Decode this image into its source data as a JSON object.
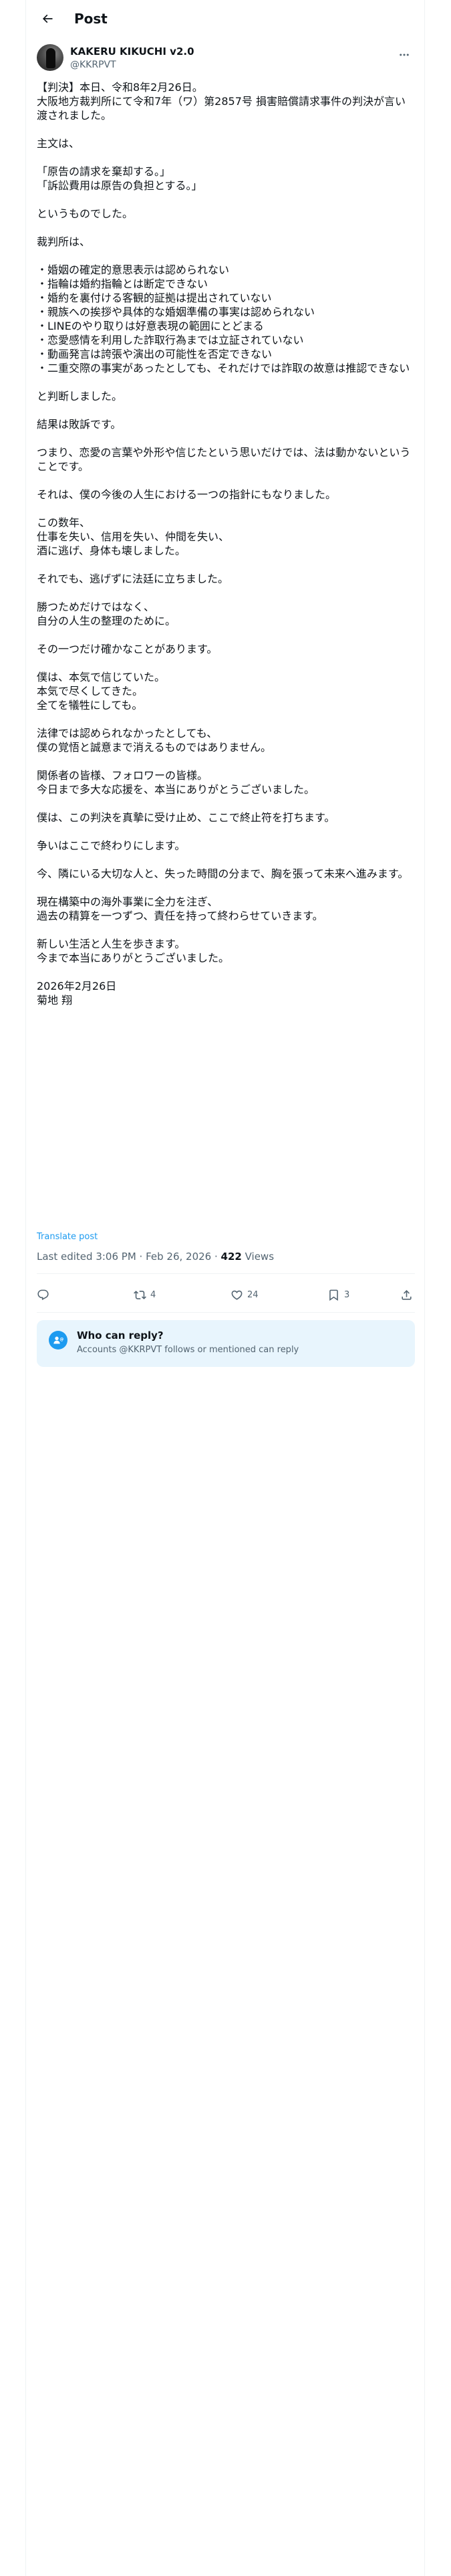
{
  "header": {
    "title": "Post"
  },
  "author": {
    "name": "KAKERU KIKUCHI v2.0",
    "handle": "@KKRPVT"
  },
  "post": {
    "text": "【判決】本日、令和8年2月26日。\n大阪地方裁判所にて令和7年（ワ）第2857号 損害賠償請求事件の判決が言い渡されました。\n\n主文は、\n\n「原告の請求を棄却する。」\n「訴訟費用は原告の負担とする。」\n\nというものでした。\n\n裁判所は、\n\n・婚姻の確定的意思表示は認められない\n・指輪は婚約指輪とは断定できない\n・婚約を裏付ける客観的証拠は提出されていない\n・親族への挨拶や具体的な婚姻準備の事実は認められない\n・LINEのやり取りは好意表現の範囲にとどまる\n・恋愛感情を利用した詐取行為までは立証されていない\n・動画発言は誇張や演出の可能性を否定できない\n・二重交際の事実があったとしても、それだけでは詐取の故意は推認できない\n\nと判断しました。\n\n結果は敗訴です。\n\nつまり、恋愛の言葉や外形や信じたという思いだけでは、法は動かないということです。\n\nそれは、僕の今後の人生における一つの指針にもなりました。\n\nこの数年、\n仕事を失い、信用を失い、仲間を失い、\n酒に逃げ、身体も壊しました。\n\nそれでも、逃げずに法廷に立ちました。\n\n勝つためだけではなく、\n自分の人生の整理のために。\n\nその一つだけ確かなことがあります。\n\n僕は、本気で信じていた。\n本気で尽くしてきた。\n全てを犠牲にしても。\n\n法律では認められなかったとしても、\n僕の覚悟と誠意まで消えるものではありません。\n\n関係者の皆様、フォロワーの皆様。\n今日まで多大な応援を、本当にありがとうございました。\n\n僕は、この判決を真摯に受け止め、ここで終止符を打ちます。\n\n争いはここで終わりにします。\n\n今、隣にいる大切な人と、失った時間の分まで、胸を張って未来へ進みます。\n\n現在構築中の海外事業に全力を注ぎ、\n過去の精算を一つずつ、責任を持って終わらせていきます。\n\n新しい生活と人生を歩きます。\n今まで本当にありがとうございました。\n\n2026年2月26日\n菊地 翔",
    "translate_label": "Translate post",
    "meta_prefix": "Last edited 3:06 PM · Feb 26, 2026 · ",
    "views_count": "422",
    "views_label": " Views"
  },
  "actions": {
    "reply_icon": "reply-icon",
    "repost_count": "4",
    "like_count": "24",
    "bookmark_count": "3"
  },
  "reply_restriction": {
    "title": "Who can reply?",
    "subtitle": "Accounts @KKRPVT follows or mentioned can reply"
  },
  "colors": {
    "accent": "#1d9bf0",
    "text_primary": "#0f1419",
    "text_secondary": "#536471",
    "reply_box_bg": "#e8f5fd"
  }
}
